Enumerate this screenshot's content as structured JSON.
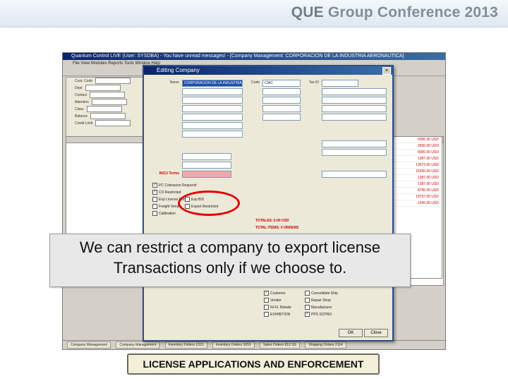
{
  "header": {
    "title_que": "QUE",
    "title_group": "Group Conference 2013"
  },
  "app": {
    "title": "Quantum Control LIVE (User: SYSDBA) - You have unread messages! - [Company Management: CORPORACION DE LA INDUSTRIA AERONAUTICA]",
    "menu": "File  View  Modules  Reports  Tools  Window  Help",
    "left_panel_rows": [
      "Cust. Code",
      "Dept",
      "Contact",
      "Attention",
      "Class",
      "Balance",
      "Credit Limit"
    ],
    "right_values": [
      "6000.00 USD",
      "2830.00 USD",
      "6000.00 USD",
      "1387.00 USD",
      "13673.00 USD",
      "15200.00 USD",
      "1387.00 USD",
      "1387.00 USD",
      "8795.00 USD",
      "18797.00 USD",
      "1200.00 USD"
    ],
    "status_tabs": [
      "Company Management",
      "Company Management",
      "Inventory Orders 1313",
      "Inventory Orders 1653",
      "Sales Orders 813 SS",
      "Shipping Orders 2114"
    ]
  },
  "dialog": {
    "title": "Editing Company",
    "name_label": "Name",
    "name_value": "CORPORACION DE LA INDUSTRIA",
    "code_label": "Code",
    "code_value": "CIAC",
    "tax_label": "Tax ID",
    "tax_value": "",
    "incu_label": "INCU Terms",
    "checks": [
      {
        "label": "PC Cotizacion Requerid",
        "checked": true
      },
      {
        "label": "CO Restricted",
        "checked": true
      },
      {
        "label": "Exp License Req",
        "checked": false
      },
      {
        "label": "Exp BIS",
        "checked": false
      },
      {
        "label": "Freight Vendor",
        "checked": false
      },
      {
        "label": "Export Restricted",
        "checked": false
      },
      {
        "label": "Calibration",
        "checked": false
      }
    ],
    "red_line1": "TOTALES: 0.00 USD",
    "red_line2": "TOTAL ITEMS: 0 ORDERS",
    "bottom_checks": [
      {
        "label": "Customer",
        "checked": true
      },
      {
        "label": "Vendor",
        "checked": false
      },
      {
        "label": "NI-FL Rebate",
        "checked": false
      },
      {
        "label": "EXHIBITION",
        "checked": false
      },
      {
        "label": "Consolidate Ship",
        "checked": false
      },
      {
        "label": "Repair Shop",
        "checked": false
      },
      {
        "label": "Manufacturer",
        "checked": false
      },
      {
        "label": "PPS SCPNO",
        "checked": true
      }
    ],
    "ok_label": "OK",
    "cancel_label": "Close"
  },
  "caption": {
    "line1": "We can restrict a company to export license",
    "line2": "Transactions only if we choose to."
  },
  "footer_label": "LICENSE APPLICATIONS AND ENFORCEMENT"
}
